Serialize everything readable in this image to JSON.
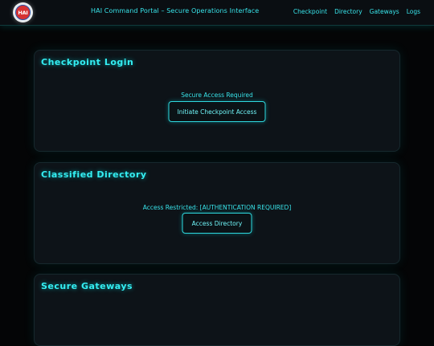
{
  "header": {
    "logo_text": "HAI",
    "title": "HAI Command Portal – Secure Operations Interface",
    "nav": [
      {
        "label": "Checkpoint"
      },
      {
        "label": "Directory"
      },
      {
        "label": "Gateways"
      },
      {
        "label": "Logs"
      }
    ]
  },
  "panels": [
    {
      "title": "Checkpoint Login",
      "status": "Secure Access Required",
      "button_label": "Initiate Checkpoint Access"
    },
    {
      "title": "Classified Directory",
      "status": "Access Restricted: [AUTHENTICATION REQUIRED]",
      "button_label": "Access Directory"
    },
    {
      "title": "Secure Gateways"
    }
  ],
  "colors": {
    "accent": "#38e4ea",
    "background": "#040506",
    "panel": "#0d1318",
    "logo_red": "#d63233",
    "logo_blue": "#2a4fa8"
  }
}
